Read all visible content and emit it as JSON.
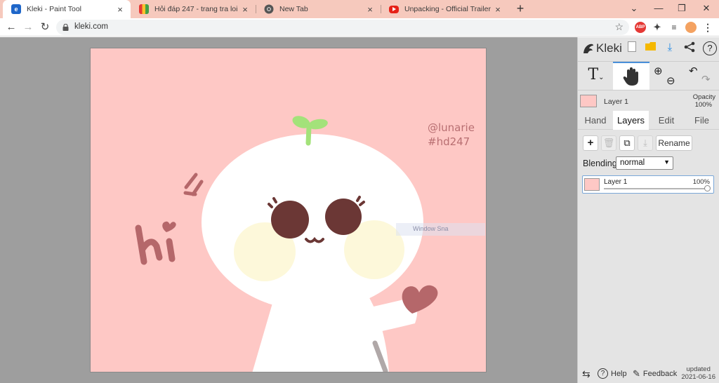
{
  "browser": {
    "tabs": [
      {
        "title": "Kleki - Paint Tool",
        "favicon": "kleki-icon",
        "active": true
      },
      {
        "title": "Hỏi đáp 247 - trang tra loi",
        "favicon": "hd247-icon",
        "active": false
      },
      {
        "title": "New Tab",
        "favicon": "chrome-icon",
        "active": false
      },
      {
        "title": "Unpacking - Official Trailer | Sum",
        "favicon": "youtube-icon",
        "active": false
      }
    ],
    "close_glyph": "×",
    "new_tab_glyph": "+",
    "window_controls": {
      "collapse": "⌄",
      "minimize": "—",
      "restore": "❐",
      "close": "✕"
    },
    "url": "kleki.com",
    "extensions": {
      "abp": "ABP"
    }
  },
  "canvas": {
    "background": "#fec8c5",
    "watermark_line1": "@lunarie",
    "watermark_line2": "#hd247",
    "ghost_overlay": "Window Sna"
  },
  "panel": {
    "brand": "Kleki",
    "layer_header": {
      "name": "Layer 1",
      "opacity_label": "Opacity",
      "opacity_value": "100%"
    },
    "subtabs": [
      "Hand",
      "Layers",
      "Edit",
      "File"
    ],
    "active_subtab": "Layers",
    "rename_label": "Rename",
    "blending_label": "Blending",
    "blending_value": "normal",
    "layers": [
      {
        "name": "Layer 1",
        "opacity": "100%",
        "opacity_fraction": 1.0
      }
    ],
    "footer": {
      "help": "Help",
      "feedback": "Feedback",
      "updated_label": "updated",
      "updated_date": "2021-06-16"
    }
  },
  "colors": {
    "accent": "#4a90d9",
    "tabstrip": "#f6c9bd",
    "workspace": "#9e9e9e",
    "panel": "#e4e4e4"
  }
}
